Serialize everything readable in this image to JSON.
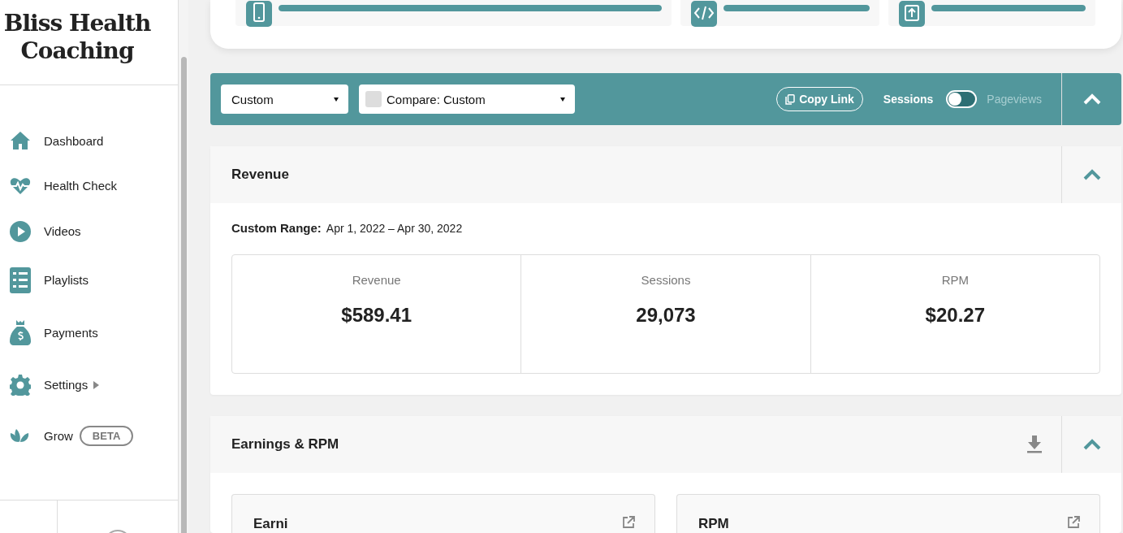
{
  "sidebar": {
    "logo": "Bliss Health Coaching",
    "items": [
      {
        "label": "Dashboard",
        "kind": "home",
        "selected": false
      },
      {
        "label": "Health Check",
        "kind": "pulse",
        "selected": false
      },
      {
        "label": "Videos",
        "kind": "play",
        "selected": false
      },
      {
        "label": "Playlists",
        "kind": "list",
        "selected": false
      },
      {
        "label": "Payments",
        "kind": "money",
        "selected": false
      },
      {
        "label": "Settings",
        "kind": "gear",
        "selected": false,
        "submenu": true
      },
      {
        "label": "Grow",
        "kind": "leaf",
        "selected": false,
        "badge": "BETA"
      }
    ]
  },
  "top_cards": [
    {
      "kind": "phone",
      "level": 1
    },
    {
      "kind": "code",
      "level": 1
    },
    {
      "kind": "upload",
      "level": 1
    }
  ],
  "filter_bar": {
    "range_select": "Custom",
    "compare_select": "Compare: Custom",
    "copy_button": "Copy Link",
    "toggle": {
      "left_label": "Sessions",
      "right_label": "Pageviews",
      "on": false
    },
    "expanded": true
  },
  "revenue_panel": {
    "title": "Revenue",
    "expanded": true,
    "range_label": "Custom Range:",
    "range_value": "Apr 1, 2022 – Apr 30, 2022",
    "stats": [
      {
        "label": "Revenue",
        "value": "$589.41"
      },
      {
        "label": "Sessions",
        "value": "29,073"
      },
      {
        "label": "RPM",
        "value": "$20.27"
      }
    ]
  },
  "earnings_panel": {
    "title": "Earnings & RPM",
    "expanded": true,
    "cards": [
      {
        "title": "Earni"
      },
      {
        "title": "RPM"
      }
    ]
  }
}
